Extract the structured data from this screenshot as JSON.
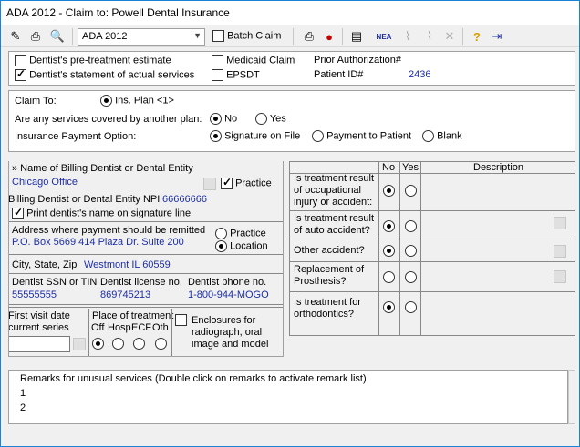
{
  "window": {
    "title": "ADA 2012 - Claim to: Powell Dental Insurance"
  },
  "toolbar": {
    "form_select": "ADA 2012",
    "batch_claim_label": "Batch Claim",
    "batch_claim_checked": false,
    "icons": [
      "edit-icon",
      "print-icon",
      "preview-icon",
      "print-send-icon",
      "person-send-icon",
      "form-icon",
      "nea-icon",
      "attach-icon",
      "attach2-icon",
      "delete-icon",
      "help-icon",
      "exit-icon"
    ],
    "nea_label": "NEA"
  },
  "claim_type": {
    "pretreatment_label": "Dentist's pre-treatment estimate",
    "pretreatment_checked": false,
    "actual_services_label": "Dentist's statement of actual services",
    "actual_services_checked": true,
    "medicaid_label": "Medicaid Claim",
    "medicaid_checked": false,
    "epsdt_label": "EPSDT",
    "epsdt_checked": false,
    "prior_auth_label": "Prior Authorization#",
    "patient_id_label": "Patient ID#",
    "patient_id_value": "2436"
  },
  "insurance": {
    "claim_to_label": "Claim To:",
    "claim_to_option": "Ins. Plan <1>",
    "other_plan_question": "Are any services covered by another plan:",
    "other_plan_no": "No",
    "other_plan_yes": "Yes",
    "other_plan_selected": "No",
    "payment_option_label": "Insurance Payment Option:",
    "payment_signature": "Signature on File",
    "payment_patient": "Payment to Patient",
    "payment_blank": "Blank",
    "payment_selected": "Signature on File"
  },
  "billing": {
    "name_label": "» Name of Billing Dentist or Dental Entity",
    "name_value": "Chicago Office",
    "practice_label": "Practice",
    "practice_checked": true,
    "npi_label": "Billing Dentist or Dental Entity NPI",
    "npi_value": "66666666",
    "print_name_label": "Print dentist's name on signature line",
    "print_name_checked": true,
    "address_label": "Address where payment should be remitted",
    "address_value": "P.O. Box 5669 414 Plaza Dr. Suite 200",
    "addr_practice_label": "Practice",
    "addr_location_label": "Location",
    "addr_selected": "Location",
    "city_label": "City, State, Zip",
    "city_value": "Westmont IL 60559",
    "ssn_label": "Dentist SSN or TIN",
    "ssn_value": "55555555",
    "license_label": "Dentist license no.",
    "license_value": "869745213",
    "phone_label": "Dentist phone no.",
    "phone_value": "1-800-944-MOGO",
    "first_visit_label_1": "First visit date",
    "first_visit_label_2": "current series",
    "place_label": "Place of treatment",
    "place_options": [
      "Off",
      "Hosp",
      "ECF",
      "Oth"
    ],
    "place_selected": "Off",
    "enclosures_label_1": "Enclosures for",
    "enclosures_label_2": "radiograph,  oral",
    "enclosures_label_3": "image and model"
  },
  "treatment_table": {
    "col_no": "No",
    "col_yes": "Yes",
    "col_description": "Description",
    "rows": [
      {
        "question_1": "Is treatment result",
        "question_2": "of occupational",
        "question_3": "injury or accident:",
        "answer": "No"
      },
      {
        "question_1": "Is treatment result",
        "question_2": "of auto accident?",
        "question_3": "",
        "answer": "No"
      },
      {
        "question_1": "Other accident?",
        "question_2": "",
        "question_3": "",
        "answer": "No"
      },
      {
        "question_1": "Replacement of",
        "question_2": "Prosthesis?",
        "question_3": "",
        "answer": ""
      },
      {
        "question_1": "Is treatment for",
        "question_2": "orthodontics?",
        "question_3": "",
        "answer": "No"
      }
    ]
  },
  "remarks": {
    "label": "Remarks for unusual services (Double click on remarks to activate remark list)",
    "lines": [
      "1",
      "2"
    ]
  }
}
